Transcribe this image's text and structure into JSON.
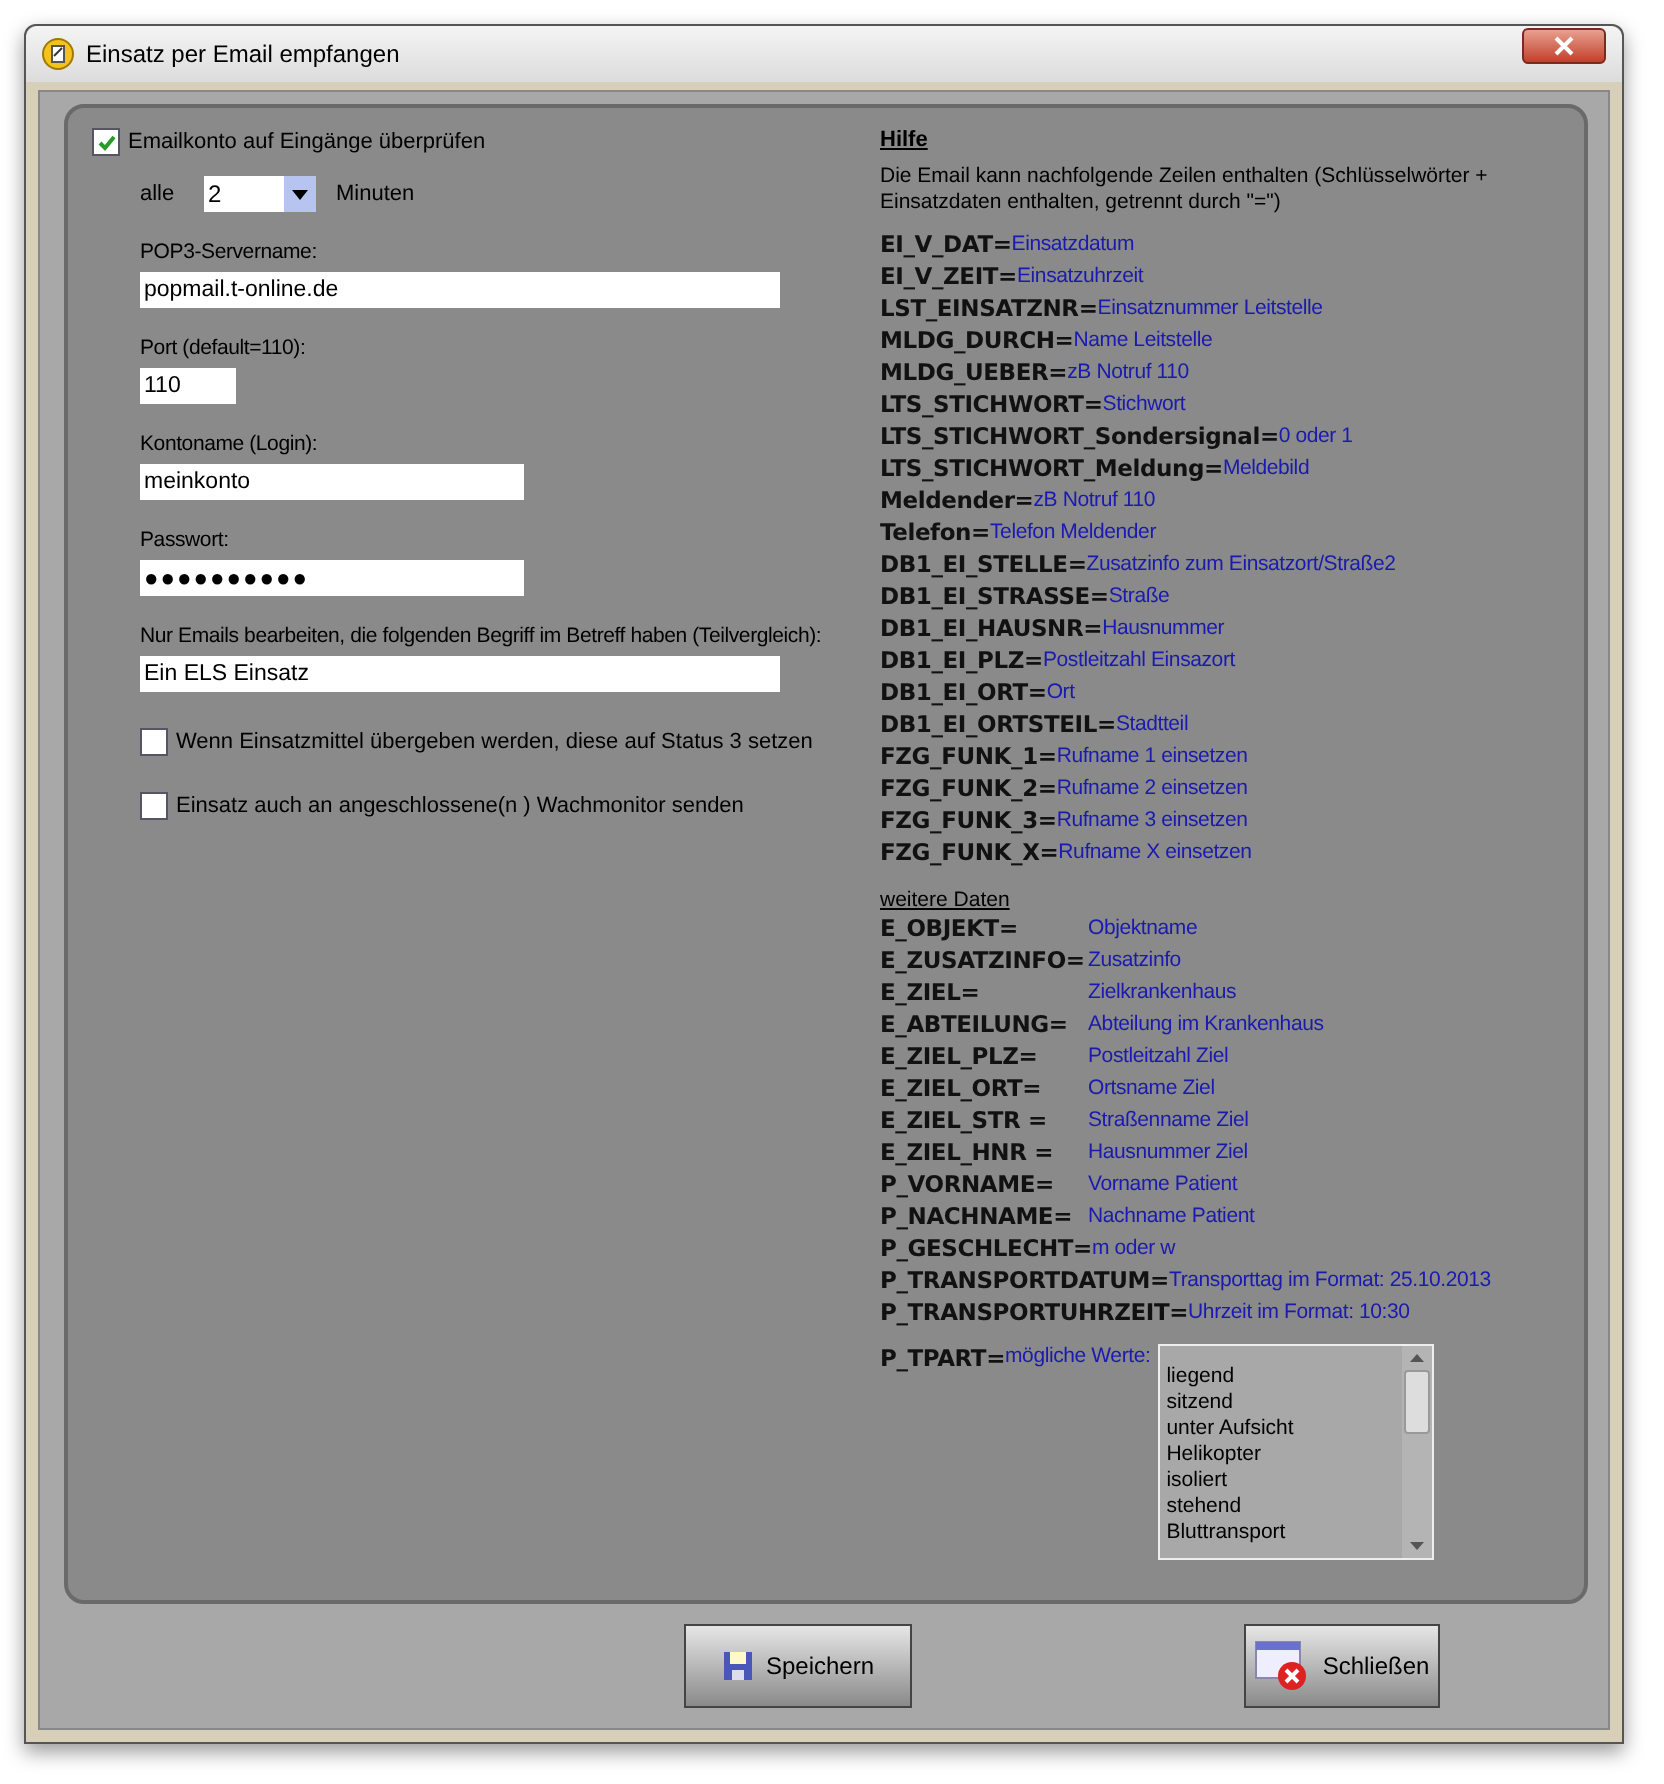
{
  "window": {
    "title": "Einsatz per Email empfangen"
  },
  "check_mail": {
    "label": "Emailkonto auf Eingänge überprüfen",
    "checked": true
  },
  "interval": {
    "prefix": "alle",
    "value": "2",
    "suffix": "Minuten"
  },
  "fields": [
    {
      "label": "POP3-Servername:",
      "value": "popmail.t-online.de",
      "kind": "wide"
    },
    {
      "label": "Port (default=110):",
      "value": "110",
      "kind": "short"
    },
    {
      "label": "Kontoname (Login):",
      "value": "meinkonto",
      "kind": "medium"
    },
    {
      "label": "Passwort:",
      "value": "●●●●●●●●●●",
      "kind": "password"
    },
    {
      "label": "Nur Emails bearbeiten, die folgenden Begriff im Betreff haben (Teilvergleich):",
      "value": "Ein ELS Einsatz",
      "kind": "wide"
    }
  ],
  "options": [
    {
      "label": "Wenn Einsatzmittel übergeben werden, diese auf Status 3 setzen",
      "checked": false
    },
    {
      "label": "Einsatz auch an angeschlossene(n ) Wachmonitor senden",
      "checked": false
    }
  ],
  "help": {
    "title": "Hilfe",
    "intro": "Die Email kann nachfolgende Zeilen enthalten (Schlüsselwörter + Einsatzdaten enthalten,  getrennt durch \"=\")",
    "keys": [
      {
        "key": "EI_V_DAT=",
        "value": "Einsatzdatum"
      },
      {
        "key": "EI_V_ZEIT=",
        "value": "Einsatzuhrzeit"
      },
      {
        "key": "LST_EINSATZNR=",
        "value": "Einsatznummer Leitstelle"
      },
      {
        "key": "MLDG_DURCH=",
        "value": "Name Leitstelle"
      },
      {
        "key": "MLDG_UEBER=",
        "value": "zB Notruf 110"
      },
      {
        "key": "LTS_STICHWORT=",
        "value": "Stichwort"
      },
      {
        "key": "LTS_STICHWORT_Sondersignal=",
        "value": "0 oder 1"
      },
      {
        "key": "LTS_STICHWORT_Meldung=",
        "value": "Meldebild"
      },
      {
        "key": "Meldender=",
        "value": "zB Notruf 110"
      },
      {
        "key": "Telefon=",
        "value": "Telefon Meldender"
      },
      {
        "key": "DB1_EI_STELLE=",
        "value": "Zusatzinfo zum Einsatzort/Straße2"
      },
      {
        "key": "DB1_EI_STRASSE=",
        "value": "Straße"
      },
      {
        "key": "DB1_EI_HAUSNR=",
        "value": "Hausnummer"
      },
      {
        "key": "DB1_EI_PLZ=",
        "value": "Postleitzahl Einsazort"
      },
      {
        "key": "DB1_EI_ORT=",
        "value": "Ort"
      },
      {
        "key": "DB1_EI_ORTSTEIL=",
        "value": "Stadtteil"
      },
      {
        "key": "FZG_FUNK_1=",
        "value": "Rufname 1 einsetzen"
      },
      {
        "key": "FZG_FUNK_2=",
        "value": "Rufname 2 einsetzen"
      },
      {
        "key": "FZG_FUNK_3=",
        "value": "Rufname 3 einsetzen"
      },
      {
        "key": "FZG_FUNK_X=",
        "value": "Rufname X einsetzen"
      }
    ],
    "more_title": "weitere Daten",
    "more_keys": [
      {
        "key": "E_OBJEKT=",
        "value": "Objektname"
      },
      {
        "key": "E_ZUSATZINFO=",
        "value": "Zusatzinfo"
      },
      {
        "key": "E_ZIEL=",
        "value": "Zielkrankenhaus"
      },
      {
        "key": "E_ABTEILUNG=",
        "value": "Abteilung im Krankenhaus"
      },
      {
        "key": "E_ZIEL_PLZ=",
        "value": "Postleitzahl Ziel"
      },
      {
        "key": "E_ZIEL_ORT=",
        "value": "Ortsname Ziel"
      },
      {
        "key": "E_ZIEL_STR =",
        "value": "Straßenname Ziel"
      },
      {
        "key": "E_ZIEL_HNR =",
        "value": "Hausnummer Ziel"
      },
      {
        "key": "P_VORNAME=",
        "value": "Vorname Patient"
      },
      {
        "key": "P_NACHNAME=",
        "value": "Nachname Patient"
      },
      {
        "key": "P_GESCHLECHT=",
        "value": "m oder w"
      },
      {
        "key": "P_TRANSPORTDATUM=",
        "value": "Transporttag im Format: 25.10.2013"
      },
      {
        "key": "P_TRANSPORTUHRZEIT=",
        "value": "Uhrzeit im Format: 10:30"
      }
    ],
    "tpart": {
      "key": "P_TPART=",
      "value": "mögliche Werte:",
      "items": [
        "liegend",
        "sitzend",
        "unter Aufsicht",
        "Helikopter",
        "isoliert",
        "stehend",
        "Bluttransport"
      ]
    }
  },
  "buttons": [
    {
      "label": "Speichern",
      "kind": "save"
    },
    {
      "label": "Schließen",
      "kind": "close"
    }
  ]
}
